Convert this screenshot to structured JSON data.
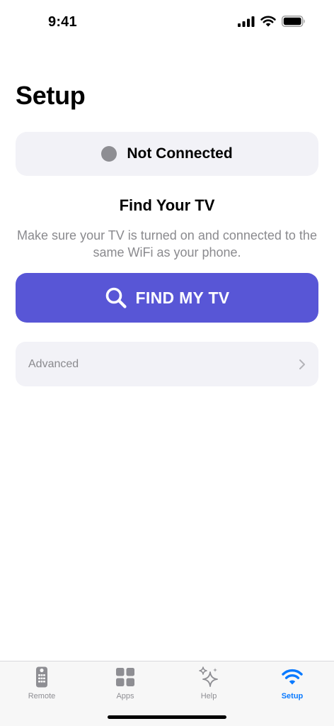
{
  "status_bar": {
    "time": "9:41",
    "icons": [
      "cellular-signal-icon",
      "wifi-icon",
      "battery-icon"
    ]
  },
  "page": {
    "title": "Setup"
  },
  "connection": {
    "status": "Not Connected",
    "dot_color": "#8e8e93"
  },
  "find_tv": {
    "heading": "Find Your TV",
    "description": "Make sure your TV is turned on and connected to the same WiFi as your phone.",
    "button_label": "FIND MY TV",
    "button_icon": "search-icon",
    "button_color": "#5856d6"
  },
  "advanced": {
    "label": "Advanced",
    "icon": "chevron-right-icon"
  },
  "tab_bar": {
    "active_color": "#0a7aff",
    "tabs": [
      {
        "label": "Remote",
        "icon": "remote-icon",
        "active": false
      },
      {
        "label": "Apps",
        "icon": "apps-grid-icon",
        "active": false
      },
      {
        "label": "Help",
        "icon": "sparkles-icon",
        "active": false
      },
      {
        "label": "Setup",
        "icon": "wifi-icon",
        "active": true
      }
    ]
  }
}
